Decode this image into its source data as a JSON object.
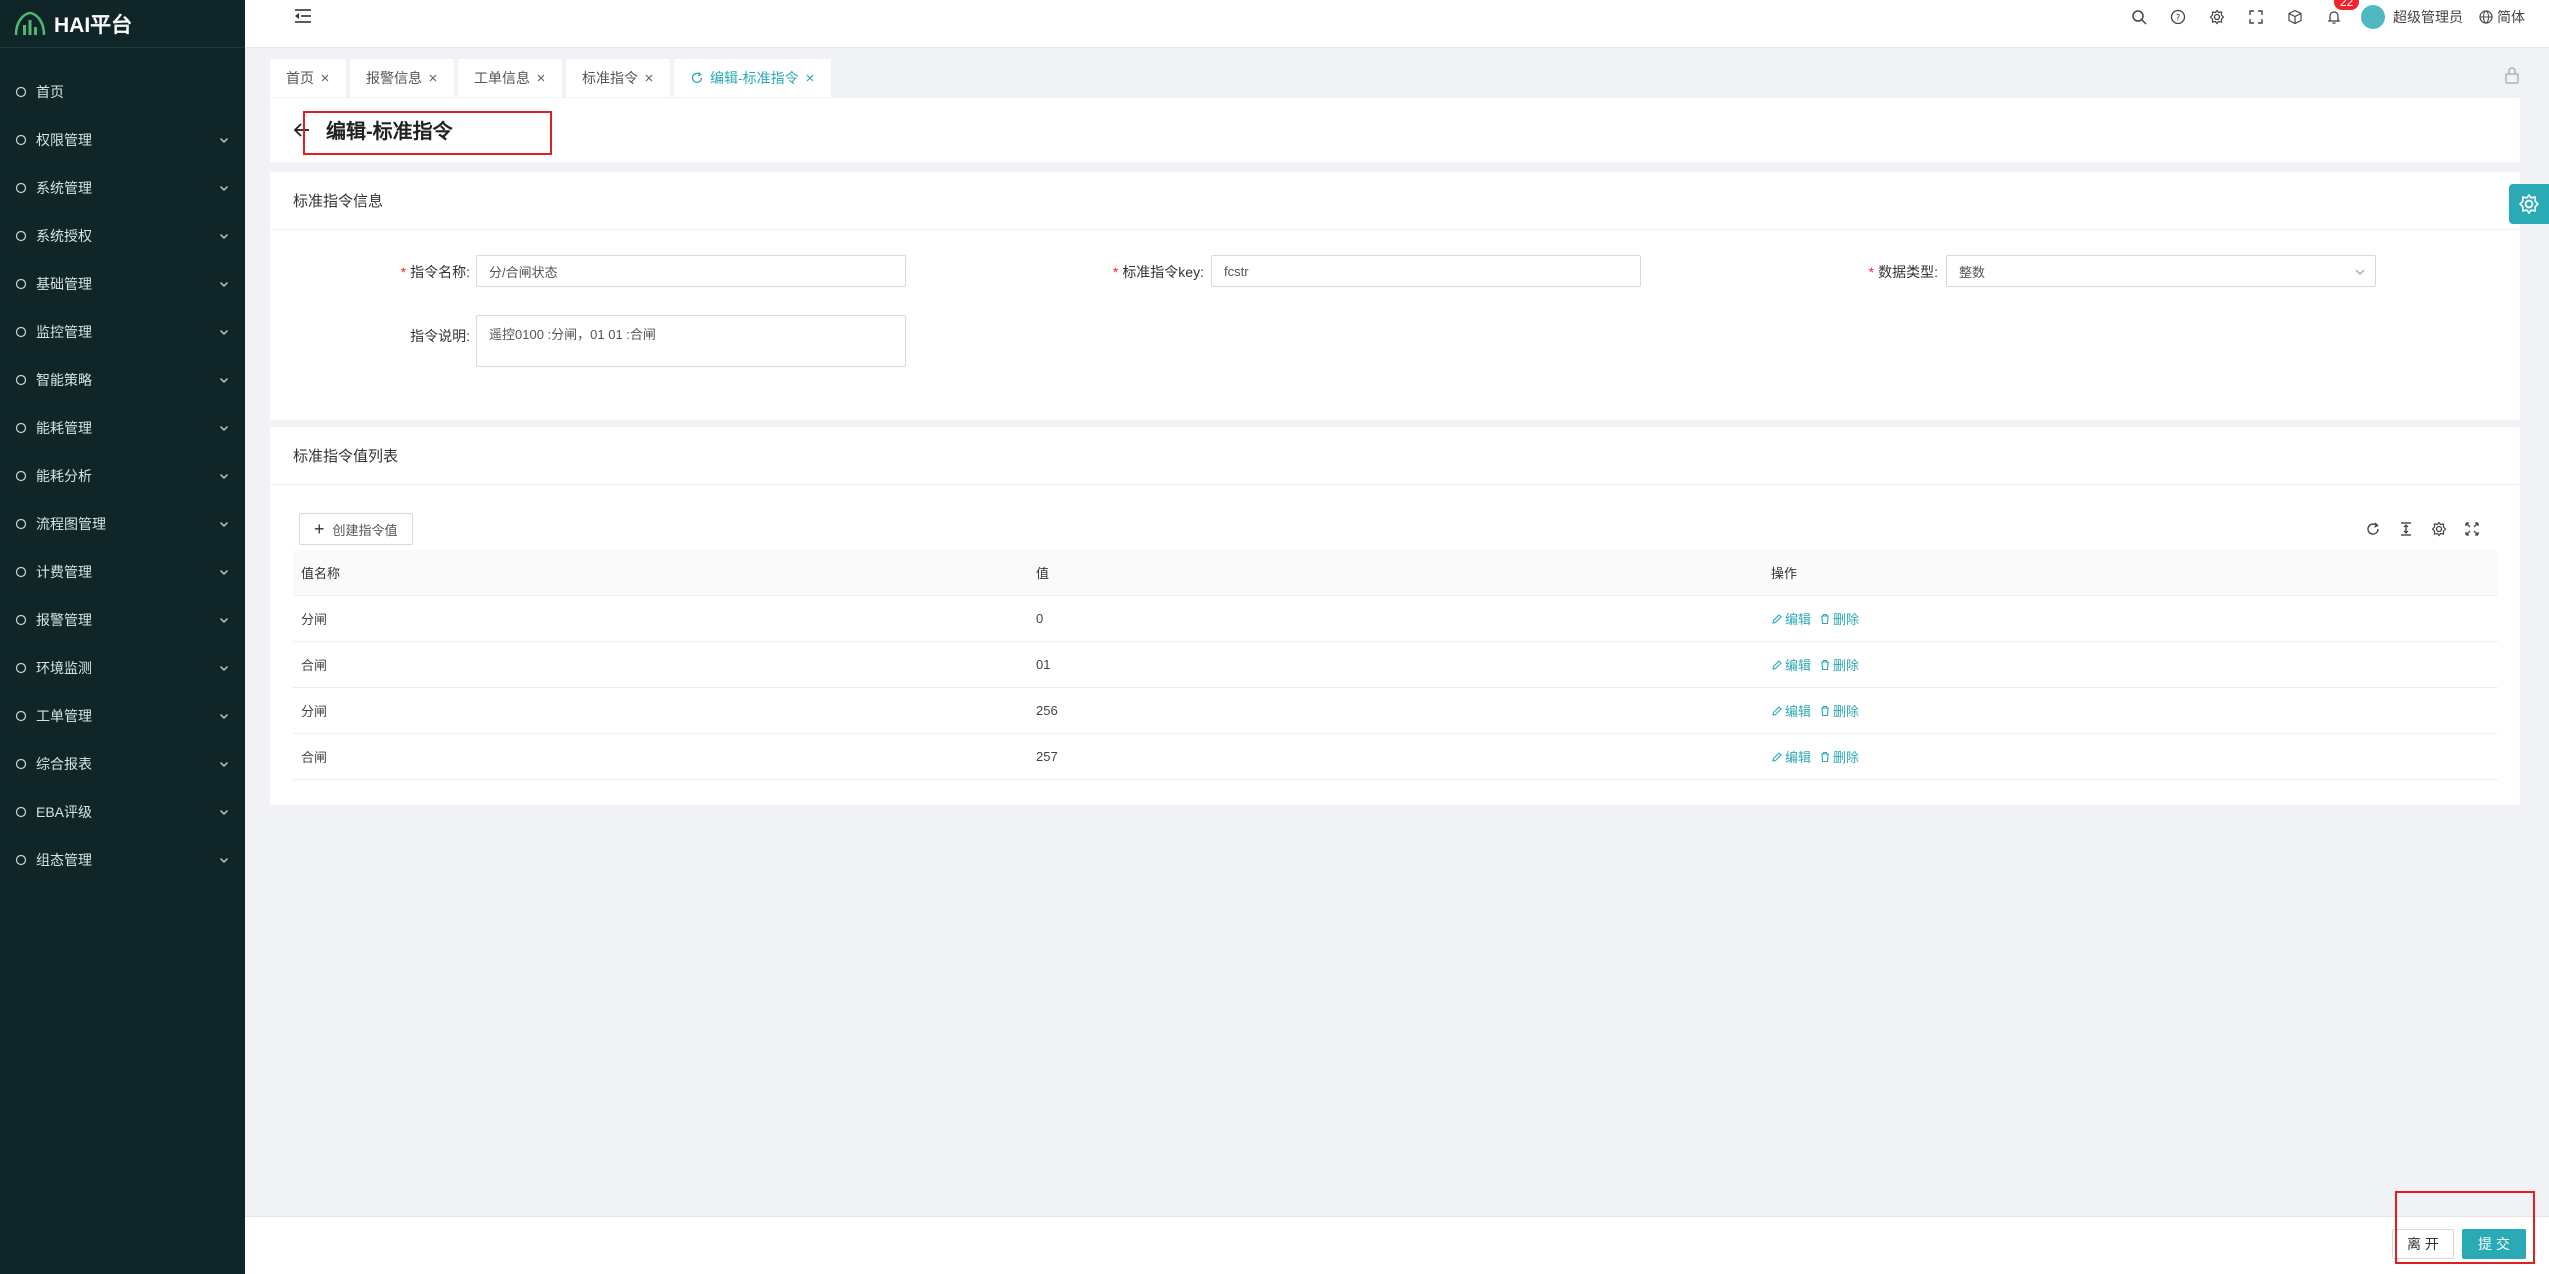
{
  "app": {
    "brand": "HAI平台"
  },
  "sidebar": {
    "items": [
      {
        "label": "首页",
        "icon": "home-icon",
        "expandable": false
      },
      {
        "label": "权限管理",
        "icon": "shield-icon",
        "expandable": true
      },
      {
        "label": "系统管理",
        "icon": "system-icon",
        "expandable": true
      },
      {
        "label": "系统授权",
        "icon": "license-icon",
        "expandable": true
      },
      {
        "label": "基础管理",
        "icon": "base-icon",
        "expandable": true
      },
      {
        "label": "监控管理",
        "icon": "monitor-icon",
        "expandable": true
      },
      {
        "label": "智能策略",
        "icon": "bulb-icon",
        "expandable": true
      },
      {
        "label": "能耗管理",
        "icon": "energy-icon",
        "expandable": true
      },
      {
        "label": "能耗分析",
        "icon": "chart-icon",
        "expandable": true
      },
      {
        "label": "流程图管理",
        "icon": "flow-icon",
        "expandable": true
      },
      {
        "label": "计费管理",
        "icon": "billing-icon",
        "expandable": true
      },
      {
        "label": "报警管理",
        "icon": "alarm-icon",
        "expandable": true
      },
      {
        "label": "环境监测",
        "icon": "leaf-icon",
        "expandable": true
      },
      {
        "label": "工单管理",
        "icon": "workorder-icon",
        "expandable": true
      },
      {
        "label": "综合报表",
        "icon": "report-icon",
        "expandable": true
      },
      {
        "label": "EBA评级",
        "icon": "rating-icon",
        "expandable": true
      },
      {
        "label": "组态管理",
        "icon": "config-icon",
        "expandable": true
      }
    ]
  },
  "header": {
    "notification_count": "22",
    "user_name": "超级管理员",
    "language": "简体"
  },
  "tabs": [
    {
      "label": "首页",
      "active": false
    },
    {
      "label": "报警信息",
      "active": false
    },
    {
      "label": "工单信息",
      "active": false
    },
    {
      "label": "标准指令",
      "active": false
    },
    {
      "label": "编辑-标准指令",
      "active": true
    }
  ],
  "page": {
    "title": "编辑-标准指令"
  },
  "info": {
    "section_title": "标准指令信息",
    "name_label": "指令名称:",
    "name_value": "分/合闸状态",
    "key_label": "标准指令key:",
    "key_value": "fcstr",
    "type_label": "数据类型:",
    "type_value": "整数",
    "desc_label": "指令说明:",
    "desc_value": "遥控0100 :分闸，01 01 :合闸"
  },
  "values_list": {
    "section_title": "标准指令值列表",
    "create_button": "创建指令值",
    "columns": [
      "值名称",
      "值",
      "操作"
    ],
    "rows": [
      {
        "name": "分闸",
        "value": "0"
      },
      {
        "name": "合闸",
        "value": "01"
      },
      {
        "name": "分闸",
        "value": "256"
      },
      {
        "name": "合闸",
        "value": "257"
      }
    ],
    "edit_label": "编辑",
    "delete_label": "删除"
  },
  "footer": {
    "leave_button": "离 开",
    "submit_button": "提 交"
  },
  "colors": {
    "accent": "#2aaab5",
    "sidebar_bg": "#0f2528",
    "highlight_box": "#e02020",
    "badge": "#f5222d"
  }
}
